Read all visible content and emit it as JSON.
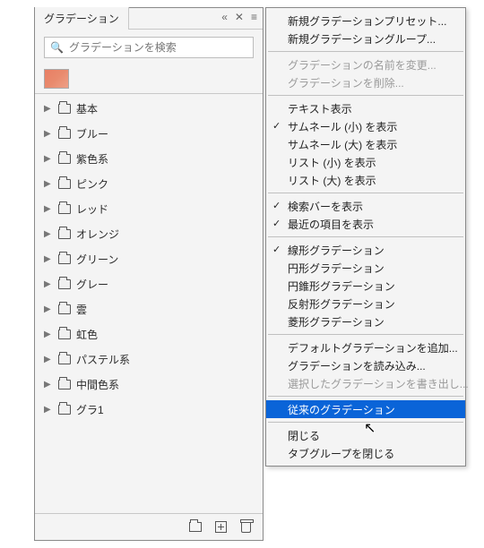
{
  "panel": {
    "tab_title": "グラデーション",
    "search_placeholder": "グラデーションを検索",
    "folders": [
      {
        "label": "基本"
      },
      {
        "label": "ブルー"
      },
      {
        "label": "紫色系"
      },
      {
        "label": "ピンク"
      },
      {
        "label": "レッド"
      },
      {
        "label": "オレンジ"
      },
      {
        "label": "グリーン"
      },
      {
        "label": "グレー"
      },
      {
        "label": "雲"
      },
      {
        "label": "虹色"
      },
      {
        "label": "パステル系"
      },
      {
        "label": "中間色系"
      },
      {
        "label": "グラ1"
      }
    ]
  },
  "menu": {
    "groups": [
      [
        {
          "label": "新規グラデーションプリセット...",
          "checked": false,
          "disabled": false
        },
        {
          "label": "新規グラデーショングループ...",
          "checked": false,
          "disabled": false
        }
      ],
      [
        {
          "label": "グラデーションの名前を変更...",
          "checked": false,
          "disabled": true
        },
        {
          "label": "グラデーションを削除...",
          "checked": false,
          "disabled": true
        }
      ],
      [
        {
          "label": "テキスト表示",
          "checked": false,
          "disabled": false
        },
        {
          "label": "サムネール (小) を表示",
          "checked": true,
          "disabled": false
        },
        {
          "label": "サムネール (大) を表示",
          "checked": false,
          "disabled": false
        },
        {
          "label": "リスト (小) を表示",
          "checked": false,
          "disabled": false
        },
        {
          "label": "リスト (大) を表示",
          "checked": false,
          "disabled": false
        }
      ],
      [
        {
          "label": "検索バーを表示",
          "checked": true,
          "disabled": false
        },
        {
          "label": "最近の項目を表示",
          "checked": true,
          "disabled": false
        }
      ],
      [
        {
          "label": "線形グラデーション",
          "checked": true,
          "disabled": false
        },
        {
          "label": "円形グラデーション",
          "checked": false,
          "disabled": false
        },
        {
          "label": "円錐形グラデーション",
          "checked": false,
          "disabled": false
        },
        {
          "label": "反射形グラデーション",
          "checked": false,
          "disabled": false
        },
        {
          "label": "菱形グラデーション",
          "checked": false,
          "disabled": false
        }
      ],
      [
        {
          "label": "デフォルトグラデーションを追加...",
          "checked": false,
          "disabled": false
        },
        {
          "label": "グラデーションを読み込み...",
          "checked": false,
          "disabled": false
        },
        {
          "label": "選択したグラデーションを書き出し...",
          "checked": false,
          "disabled": true
        }
      ],
      [
        {
          "label": "従来のグラデーション",
          "checked": false,
          "disabled": false,
          "highlight": true
        }
      ],
      [
        {
          "label": "閉じる",
          "checked": false,
          "disabled": false
        },
        {
          "label": "タブグループを閉じる",
          "checked": false,
          "disabled": false
        }
      ]
    ]
  }
}
